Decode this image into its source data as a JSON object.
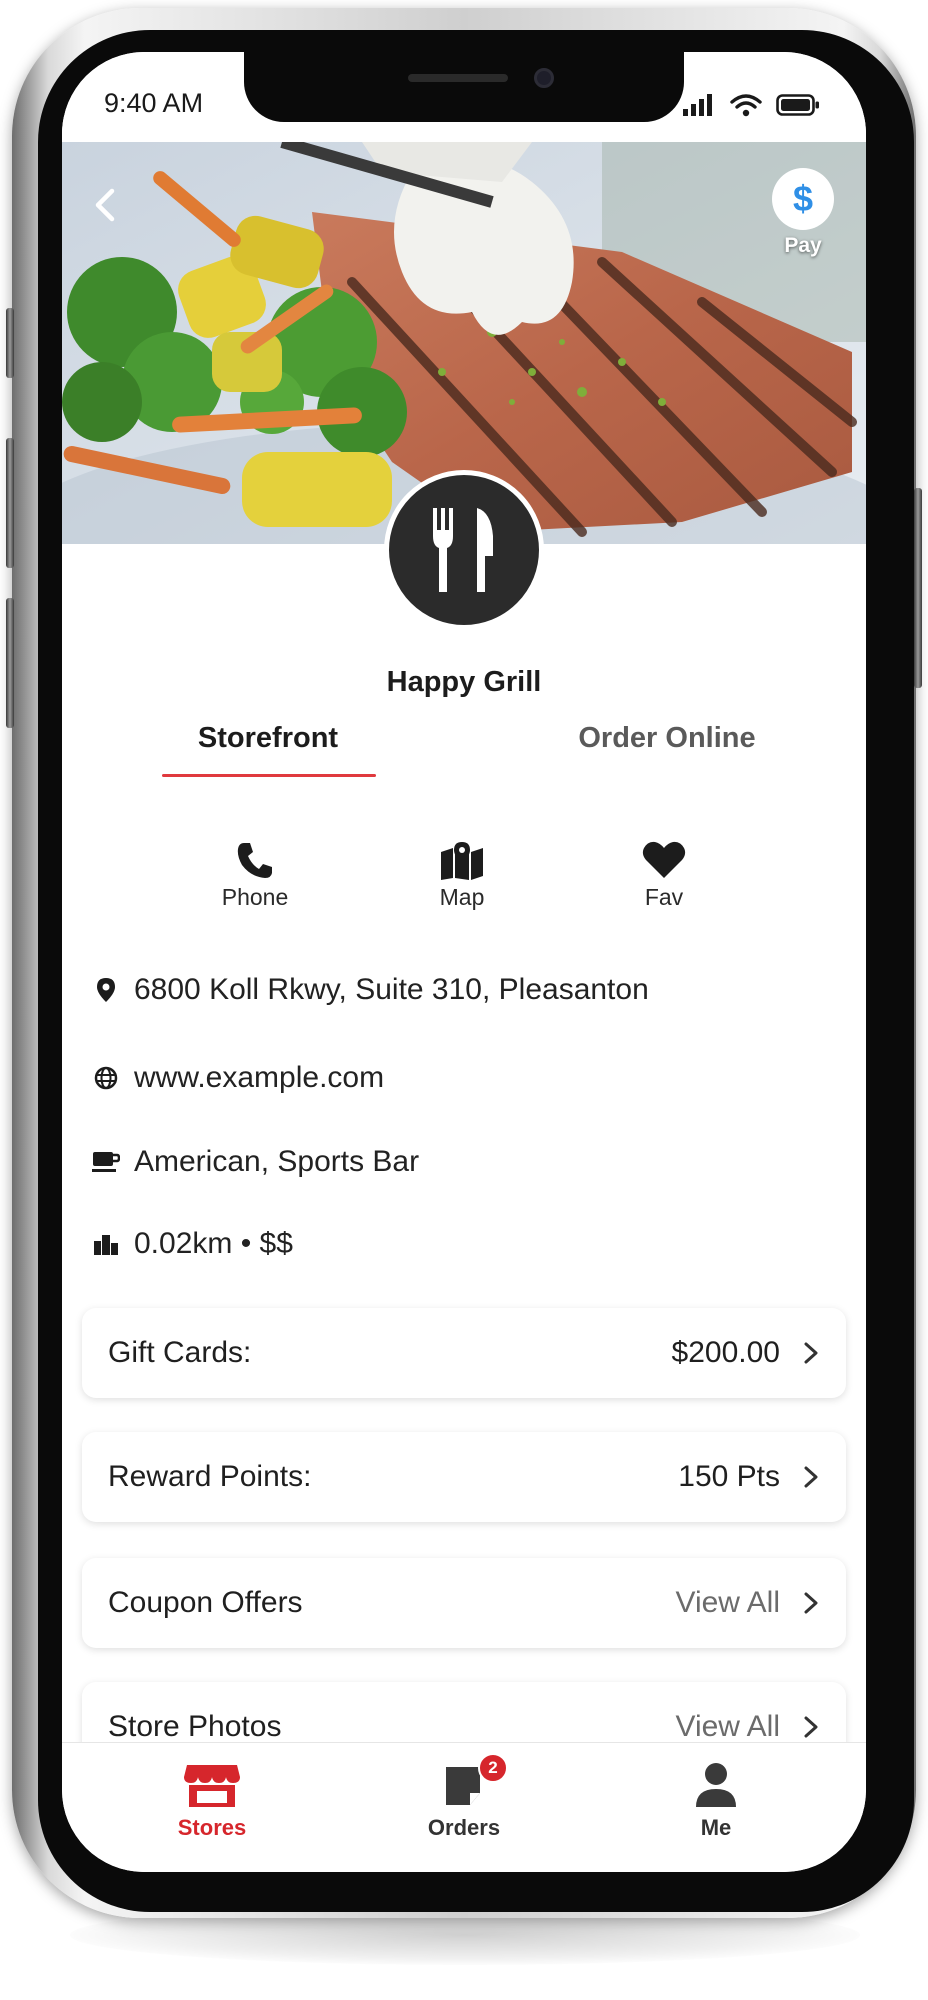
{
  "status_bar": {
    "time": "9:40 AM"
  },
  "header": {
    "pay_label": "Pay",
    "pay_symbol": "$"
  },
  "store": {
    "name": "Happy Grill"
  },
  "tabs": [
    {
      "label": "Storefront",
      "active": true
    },
    {
      "label": "Order Online",
      "active": false
    }
  ],
  "actions": [
    {
      "label": "Phone",
      "icon": "phone-icon"
    },
    {
      "label": "Map",
      "icon": "map-icon"
    },
    {
      "label": "Fav",
      "icon": "heart-icon"
    }
  ],
  "info": {
    "address": "6800 Koll Rkwy, Suite 310, Pleasanton",
    "website": "www.example.com",
    "cuisine": "American, Sports Bar",
    "distance_price": "0.02km • $$"
  },
  "cards": [
    {
      "label": "Gift Cards:",
      "value": "$200.00"
    },
    {
      "label": "Reward Points:",
      "value": "150 Pts"
    },
    {
      "label": "Coupon Offers",
      "value": "View All"
    },
    {
      "label": "Store Photos",
      "value": "View All"
    }
  ],
  "tab_bar": {
    "items": [
      {
        "label": "Stores",
        "icon": "store-icon",
        "active": true
      },
      {
        "label": "Orders",
        "icon": "orders-icon",
        "badge": "2"
      },
      {
        "label": "Me",
        "icon": "user-icon"
      }
    ]
  },
  "colors": {
    "accent": "#d6262c",
    "pay_blue": "#2f8fe6",
    "logo_bg": "#2b2b2b"
  }
}
